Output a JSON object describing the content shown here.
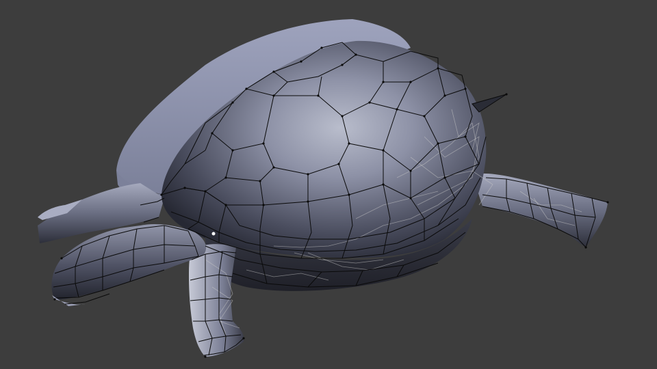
{
  "viewport": {
    "background": "#3d3d3d"
  },
  "model": {
    "object": "tortoise-mesh",
    "shading": "solid",
    "overlay": "wireframe",
    "base_color": "#8f95ad",
    "shadow_color": "#2b2d38",
    "highlight_color": "#d8dbe6",
    "wire_color": "#0a0a0a",
    "hidden_wire_color": "#c8c8c8",
    "selected_vertex_color": "#ffffff"
  }
}
